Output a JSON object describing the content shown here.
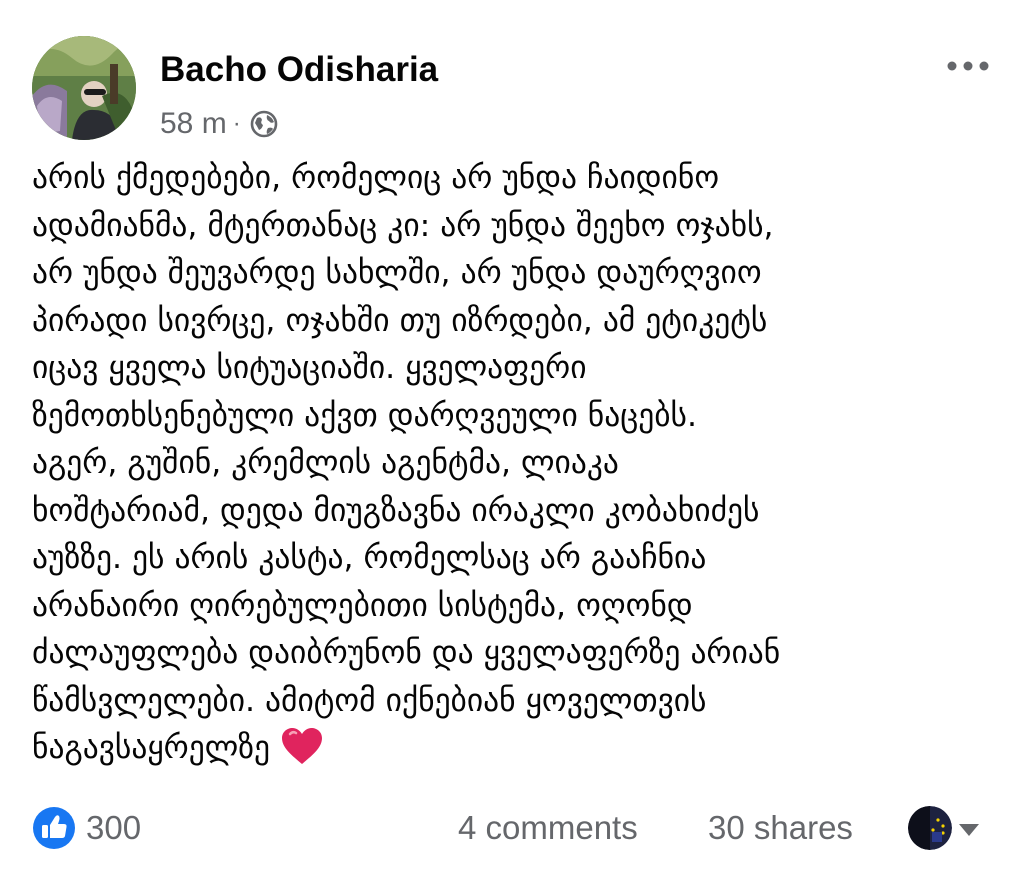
{
  "post": {
    "author": "Bacho Odisharia",
    "time": "58 m",
    "separator": "·",
    "audience_icon": "globe-icon",
    "more_icon": "more-horizontal-icon",
    "text_lines": [
      "არის ქმედებები, რომელიც არ უნდა ჩაიდინო",
      "ადამიანმა, მტერთანაც კი: არ უნდა შეეხო ოჯახს,",
      "არ უნდა შეუვარდე სახლში, არ უნდა დაურღვიო",
      "პირადი სივრცე, ოჯახში თუ იზრდები, ამ ეტიკეტს",
      "იცავ ყველა სიტუაციაში. ყველაფერი",
      "ზემოთხსენებული აქვთ დარღვეული ნაცებს.",
      "აგერ, გუშინ, კრემლის აგენტმა, ლიაკა",
      "ხოშტარიამ, დედა მიუგზავნა ირაკლი კობახიძეს",
      "აუზზე. ეს არის კასტა, რომელსაც არ გააჩნია",
      "არანაირი ღირებულებითი სისტემა, ოღონდ",
      "ძალაუფლება დაიბრუნონ და ყველაფერზე არიან",
      "წამსვლელები. ამიტომ იქნებიან ყოველთვის",
      "ნაგავსაყრელზე"
    ],
    "emoji": "heart-emoji"
  },
  "footer": {
    "like_icon": "like-icon",
    "likes": "300",
    "comments": "4 comments",
    "shares": "30 shares",
    "caret_icon": "caret-down-icon"
  },
  "colors": {
    "text": "#050505",
    "secondary_text": "#65676b",
    "like_blue": "#1877f2",
    "heart_red": "#e0245e"
  }
}
